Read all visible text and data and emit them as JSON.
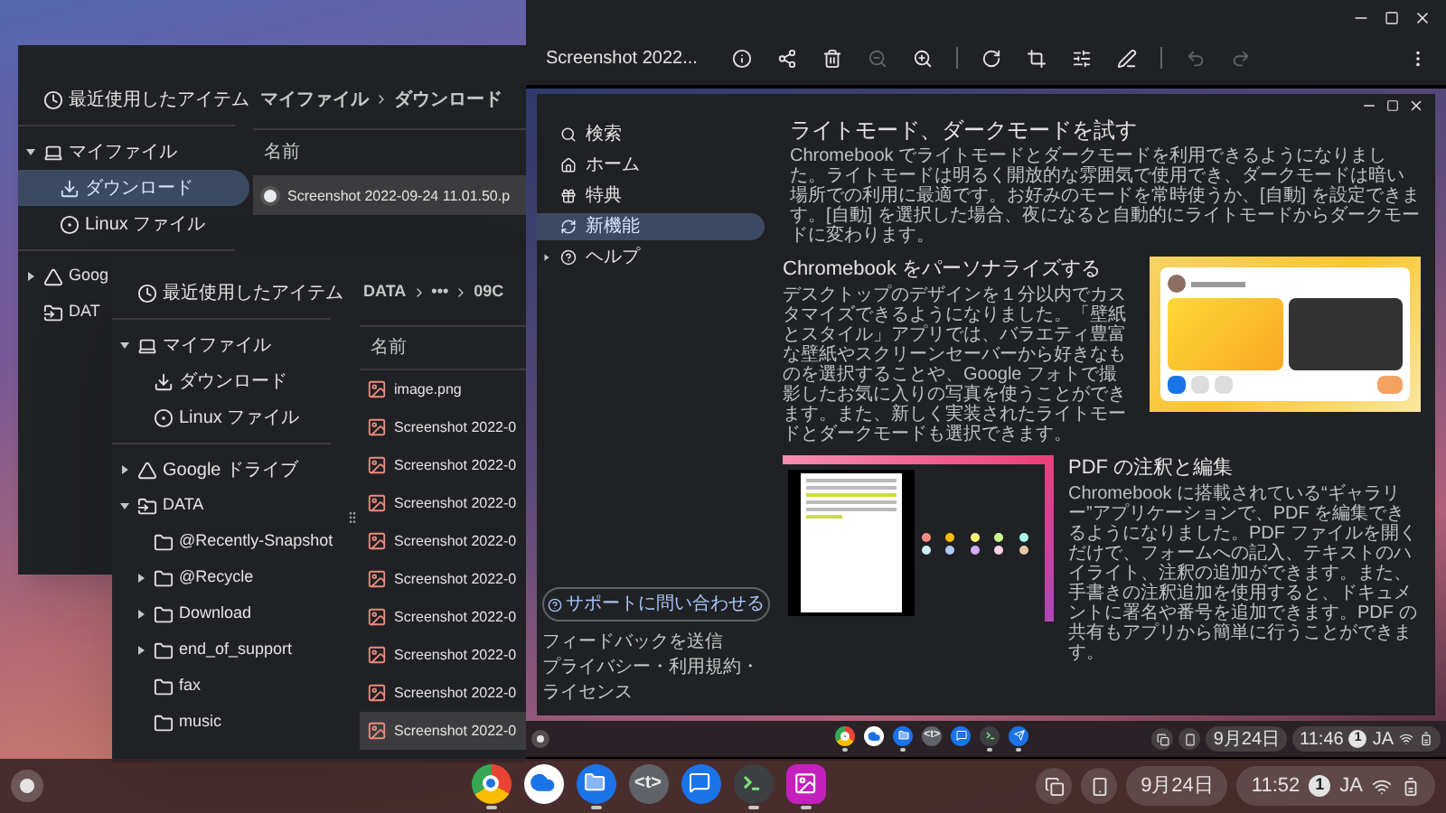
{
  "back_files_window": {
    "sidebar": [
      {
        "kind": "recent",
        "label": "最近使用したアイテム",
        "expandable": false,
        "selected": false
      },
      {
        "kind": "computer",
        "label": "マイファイル",
        "expandable": true,
        "expanded": true,
        "selected": false,
        "children": [
          {
            "kind": "download",
            "label": "ダウンロード",
            "expandable": false,
            "selected": true
          },
          {
            "kind": "linux",
            "label": "Linux ファイル",
            "expandable": false,
            "selected": false
          }
        ]
      },
      {
        "kind": "drive",
        "label": "Goog",
        "expandable": true,
        "expanded": false,
        "selected": false
      },
      {
        "kind": "data",
        "label": "DAT",
        "expandable": false,
        "selected": false
      }
    ],
    "breadcrumb": [
      "マイファイル",
      "ダウンロード"
    ],
    "column_header": "名前",
    "files": [
      {
        "kind": "thumbnail",
        "name": "Screenshot 2022-09-24 11.01.50.p",
        "selected": true
      }
    ]
  },
  "front_files_window": {
    "sidebar": [
      {
        "kind": "recent",
        "label": "最近使用したアイテム",
        "expandable": false,
        "selected": false
      },
      {
        "kind": "computer",
        "label": "マイファイル",
        "expandable": true,
        "expanded": true,
        "selected": false,
        "children": [
          {
            "kind": "download",
            "label": "ダウンロード",
            "expandable": false,
            "selected": false
          },
          {
            "kind": "linux",
            "label": "Linux ファイル",
            "expandable": false,
            "selected": false
          }
        ]
      },
      {
        "kind": "drive",
        "label": "Google ドライブ",
        "expandable": true,
        "expanded": false,
        "selected": false
      },
      {
        "kind": "data",
        "label": "DATA",
        "expandable": true,
        "expanded": true,
        "selected": false,
        "children": [
          {
            "kind": "folder",
            "label": "@Recently-Snapshot",
            "expandable": false,
            "selected": false
          },
          {
            "kind": "folder",
            "label": "@Recycle",
            "expandable": true,
            "expanded": false,
            "selected": false
          },
          {
            "kind": "folder",
            "label": "Download",
            "expandable": true,
            "expanded": false,
            "selected": false
          },
          {
            "kind": "folder",
            "label": "end_of_support",
            "expandable": true,
            "expanded": false,
            "selected": false
          },
          {
            "kind": "folder",
            "label": "fax",
            "expandable": false,
            "selected": false
          },
          {
            "kind": "folder",
            "label": "music",
            "expandable": false,
            "selected": false
          }
        ]
      }
    ],
    "breadcrumb": [
      "DATA",
      "•••",
      "09C"
    ],
    "column_header": "名前",
    "files": [
      {
        "kind": "image",
        "name": "image.png",
        "selected": false
      },
      {
        "kind": "image",
        "name": "Screenshot 2022-0",
        "selected": false
      },
      {
        "kind": "image",
        "name": "Screenshot 2022-0",
        "selected": false
      },
      {
        "kind": "image",
        "name": "Screenshot 2022-0",
        "selected": false
      },
      {
        "kind": "image",
        "name": "Screenshot 2022-0",
        "selected": false
      },
      {
        "kind": "image",
        "name": "Screenshot 2022-0",
        "selected": false
      },
      {
        "kind": "image",
        "name": "Screenshot 2022-0",
        "selected": false
      },
      {
        "kind": "image",
        "name": "Screenshot 2022-0",
        "selected": false
      },
      {
        "kind": "image",
        "name": "Screenshot 2022-0",
        "selected": false
      },
      {
        "kind": "image",
        "name": "Screenshot 2022-0",
        "selected": true
      }
    ]
  },
  "image_viewer": {
    "title": "Screenshot 2022...",
    "toolbar_groups": [
      [
        {
          "kind": "info",
          "disabled": false
        },
        {
          "kind": "share",
          "disabled": false
        },
        {
          "kind": "delete",
          "disabled": false
        },
        {
          "kind": "zoom_out",
          "disabled": true
        },
        {
          "kind": "zoom_in",
          "disabled": false
        }
      ],
      [
        {
          "kind": "rotate",
          "disabled": false
        },
        {
          "kind": "crop",
          "disabled": false
        },
        {
          "kind": "adjust",
          "disabled": false
        },
        {
          "kind": "annotate",
          "disabled": false
        }
      ],
      [
        {
          "kind": "undo",
          "disabled": true
        },
        {
          "kind": "redo",
          "disabled": true
        }
      ]
    ],
    "screenshot": {
      "explore": {
        "nav": [
          {
            "kind": "search",
            "label": "検索",
            "expandable": false,
            "selected": false
          },
          {
            "kind": "home",
            "label": "ホーム",
            "expandable": false,
            "selected": false
          },
          {
            "kind": "perks",
            "label": "特典",
            "expandable": false,
            "selected": false
          },
          {
            "kind": "whats_new",
            "label": "新機能",
            "expandable": false,
            "selected": true
          },
          {
            "kind": "help",
            "label": "ヘルプ",
            "expandable": true,
            "selected": false
          }
        ],
        "support_button": "サポートに問い合わせる",
        "footer_links": [
          "フィードバックを送信",
          "プライバシー・利用規約・",
          "ライセンス"
        ],
        "sections": [
          {
            "kind": "intro",
            "title": "ライトモード、ダークモードを試す",
            "text": "Chromebook でライトモードとダークモードを利用できるようになりました。ライトモードは明るく開放的な雰囲気で使用でき、ダークモードは暗い場所での利用に最適です。お好みのモードを常時使うか、[自動] を設定できます。[自動] を選択した場合、夜になると自動的にライトモードからダークモードに変わります。"
          },
          {
            "kind": "image_right",
            "title": "Chromebook をパーソナライズする",
            "text": "デスクトップのデザインを１分以内でカスタマイズできるようになりました。「壁紙とスタイル」アプリでは、バラエティ豊富な壁紙やスクリーンセーバーから好きなものを選択することや、Google フォトで撮影したお気に入りの写真を使うことができます。また、新しく実装されたライトモードとダークモードも選択できます。"
          },
          {
            "kind": "image_left",
            "title": "PDF の注釈と編集",
            "text": "Chromebook に搭載されている“ギャラリー”アプリケーションで、PDF を編集できるようになりました。PDF ファイルを開くだけで、フォームへの記入、テキストのハイライト、注釈の追加ができます。また、手書きの注釈追加を使用すると、ドキュメントに署名や番号を追加できます。PDF の共有もアプリから簡単に行うことができます。"
          }
        ]
      },
      "shelf": {
        "apps": [
          {
            "kind": "chrome",
            "open": true
          },
          {
            "kind": "cloud",
            "open": false
          },
          {
            "kind": "files",
            "open": true
          },
          {
            "kind": "text",
            "glyph": "<t>",
            "open": false
          },
          {
            "kind": "message",
            "open": false
          },
          {
            "kind": "terminal",
            "open": true
          },
          {
            "kind": "explore",
            "open": true
          }
        ],
        "date": "9月24日",
        "time": "11:46",
        "notifications": "1",
        "ime": "JA"
      }
    }
  },
  "shelf": {
    "apps": [
      {
        "kind": "chrome",
        "open": true
      },
      {
        "kind": "cloud",
        "open": false
      },
      {
        "kind": "files",
        "open": true
      },
      {
        "kind": "text",
        "glyph": "<t>",
        "open": false
      },
      {
        "kind": "message",
        "open": false
      },
      {
        "kind": "terminal",
        "open": true
      },
      {
        "kind": "gallery",
        "open": true
      }
    ],
    "date": "9月24日",
    "time": "11:52",
    "notifications": "1",
    "ime": "JA"
  }
}
